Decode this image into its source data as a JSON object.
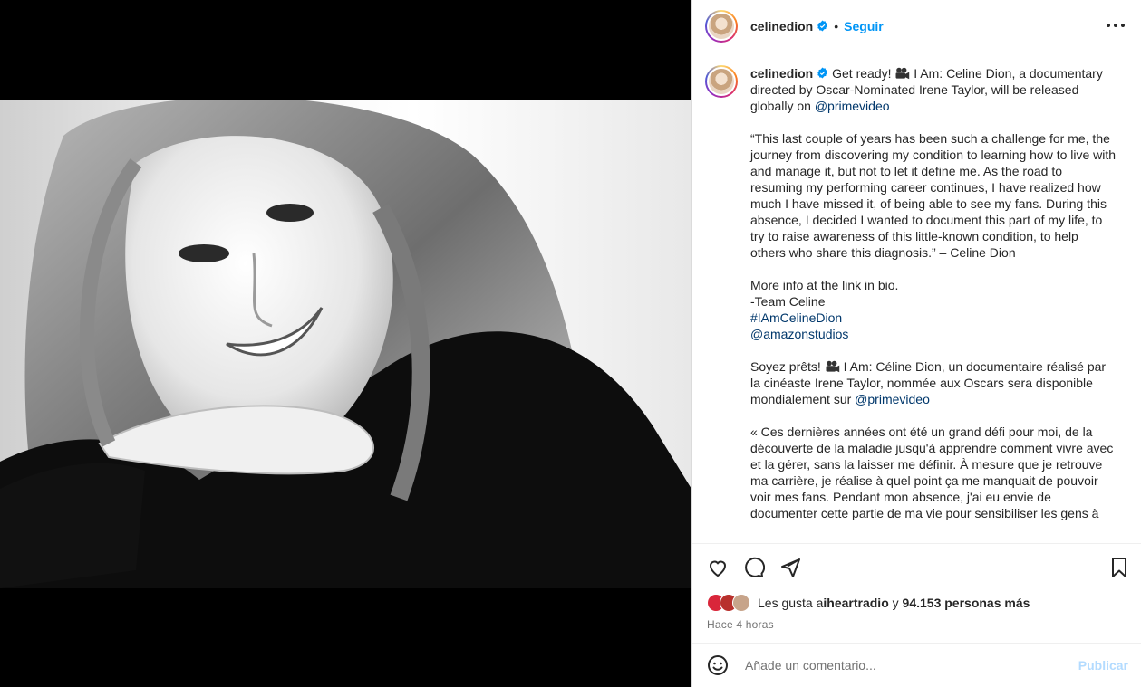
{
  "header": {
    "username": "celinedion",
    "separator": "•",
    "follow_label": "Seguir"
  },
  "caption": {
    "username": "celinedion",
    "p1_text": "Get ready! ",
    "p1_rest": " I Am: Celine Dion, a documentary directed by Oscar-Nominated Irene Taylor, will be released globally on ",
    "p1_mention": "@primevideo",
    "p2": "“This last couple of years has been such a challenge for me, the journey from discovering my condition to learning how to live with and manage it, but not to let it define me. As the road to resuming my performing career continues, I have realized how much I have missed it, of being able to see my fans. During this absence, I decided I wanted to document this part of my life, to try to raise awareness of this little-known condition, to help others who share this diagnosis.” – Celine Dion",
    "p3_line1": "More info at the link in bio.",
    "p3_line2": "-Team Celine",
    "p3_hashtag": "#IAmCelineDion",
    "p3_mention": "@amazonstudios",
    "p4_text": "Soyez prêts! ",
    "p4_rest": " I Am: Céline Dion, un documentaire réalisé par la cinéaste Irene Taylor, nommée aux Oscars sera disponible mondialement sur ",
    "p4_mention": "@primevideo",
    "p5": "« Ces dernières années ont été un grand défi pour moi, de la découverte de la maladie jusqu'à apprendre comment vivre avec et la gérer, sans la laisser me définir. À mesure que je retrouve ma carrière, je réalise à quel point ça me manquait de pouvoir voir mes fans. Pendant mon absence, j'ai eu envie de documenter cette partie de ma vie pour sensibiliser les gens à"
  },
  "likes": {
    "prefix": "Les gusta a ",
    "first_user": "iheartradio",
    "middle": " y ",
    "others": "94.153 personas más"
  },
  "time": "Hace 4 horas",
  "comment": {
    "placeholder": "Añade un comentario...",
    "publish_label": "Publicar"
  },
  "colors": {
    "link": "#00376b",
    "follow": "#0095f6",
    "publish_disabled": "#b3dbff"
  },
  "icons": [
    "more-icon",
    "verified-icon",
    "video-camera-icon",
    "heart-icon",
    "comment-icon",
    "share-icon",
    "bookmark-icon",
    "emoji-icon"
  ]
}
